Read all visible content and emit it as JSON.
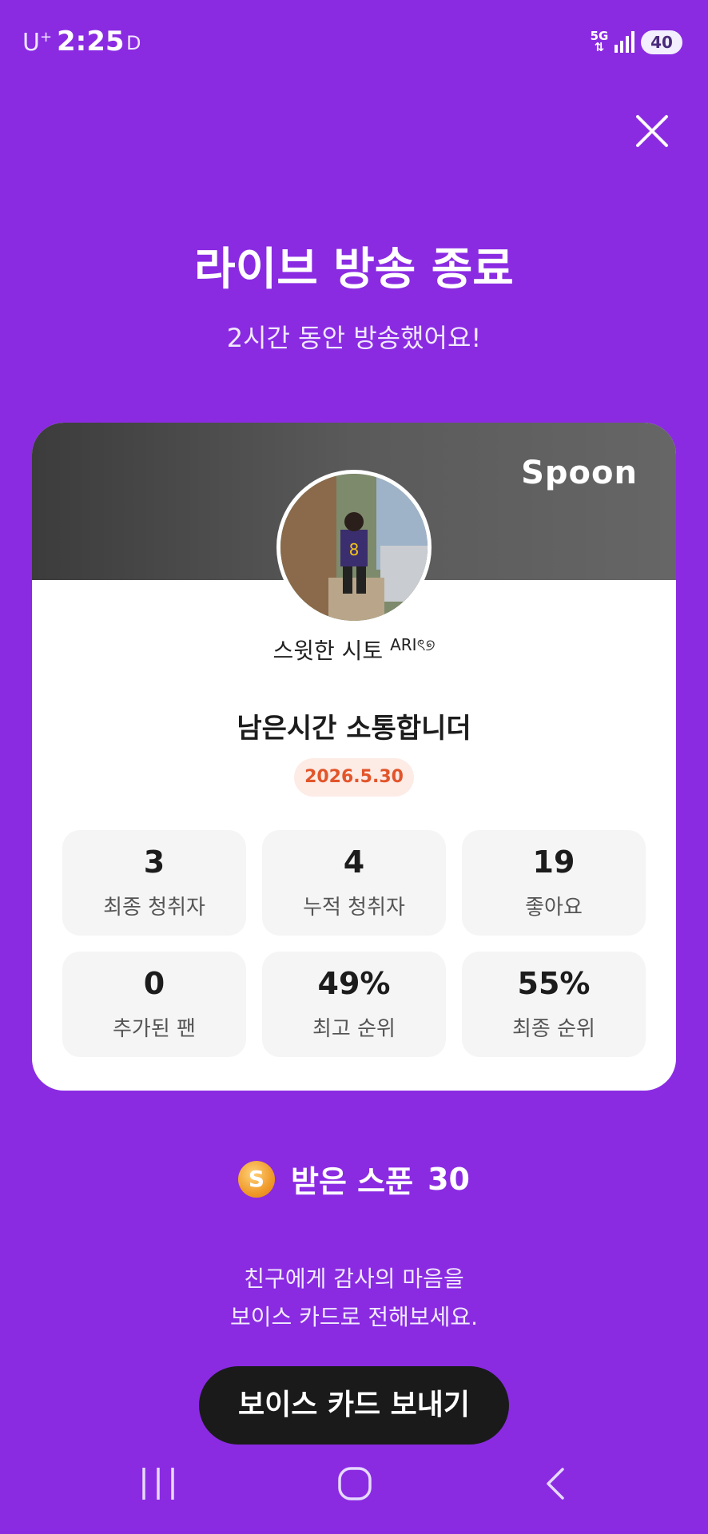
{
  "status_bar": {
    "carrier": "U",
    "carrier_sup": "+",
    "time": "2:25",
    "dnd": "D",
    "network": "5G",
    "battery": "40"
  },
  "header": {
    "title": "라이브 방송 종료",
    "subtitle": "2시간 동안 방송했어요!"
  },
  "card": {
    "brand": "Spoon",
    "nickname": "스윗한 시토",
    "nickname_tag": "ARI",
    "nickname_suffix": "ৎ୭",
    "live_title": "남은시간 소통합니더",
    "date": "2026.5.30",
    "stats": [
      {
        "value": "3",
        "label": "최종 청취자"
      },
      {
        "value": "4",
        "label": "누적 청취자"
      },
      {
        "value": "19",
        "label": "좋아요"
      },
      {
        "value": "0",
        "label": "추가된 팬"
      },
      {
        "value": "49%",
        "label": "최고 순위"
      },
      {
        "value": "55%",
        "label": "최종 순위"
      }
    ]
  },
  "spoons": {
    "coin_letter": "S",
    "label": "받은 스푼",
    "count": "30"
  },
  "thanks": {
    "line1": "친구에게 감사의 마음을",
    "line2": "보이스 카드로 전해보세요."
  },
  "send_button": "보이스 카드 보내기",
  "colors": {
    "background": "#8a2be2",
    "date_text": "#e2552a",
    "date_bg": "#fdebe5",
    "button": "#1a1a1a"
  }
}
